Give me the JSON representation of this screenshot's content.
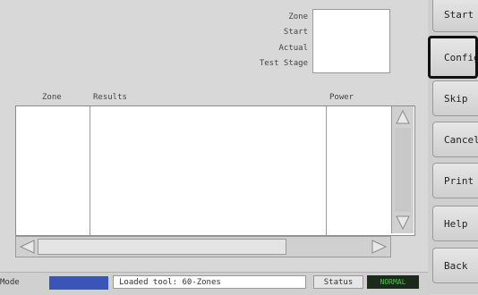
{
  "fields": {
    "zone_label": "Zone",
    "start_label": "Start",
    "actual_label": "Actual",
    "test_stage_label": "Test Stage"
  },
  "table": {
    "columns": [
      "Zone",
      "Results",
      "Power"
    ]
  },
  "buttons": [
    "Start",
    "Config",
    "Skip",
    "Cancel",
    "Print",
    "Help",
    "Back"
  ],
  "statusbar": {
    "mode_label": "Mode",
    "message": "Loaded tool: 60-Zones",
    "status_label": "Status",
    "status_value": "NORMAL",
    "mode_color": "#3b54b8",
    "status_bg": "#1b2a1b",
    "status_fg": "#3ad03a"
  }
}
